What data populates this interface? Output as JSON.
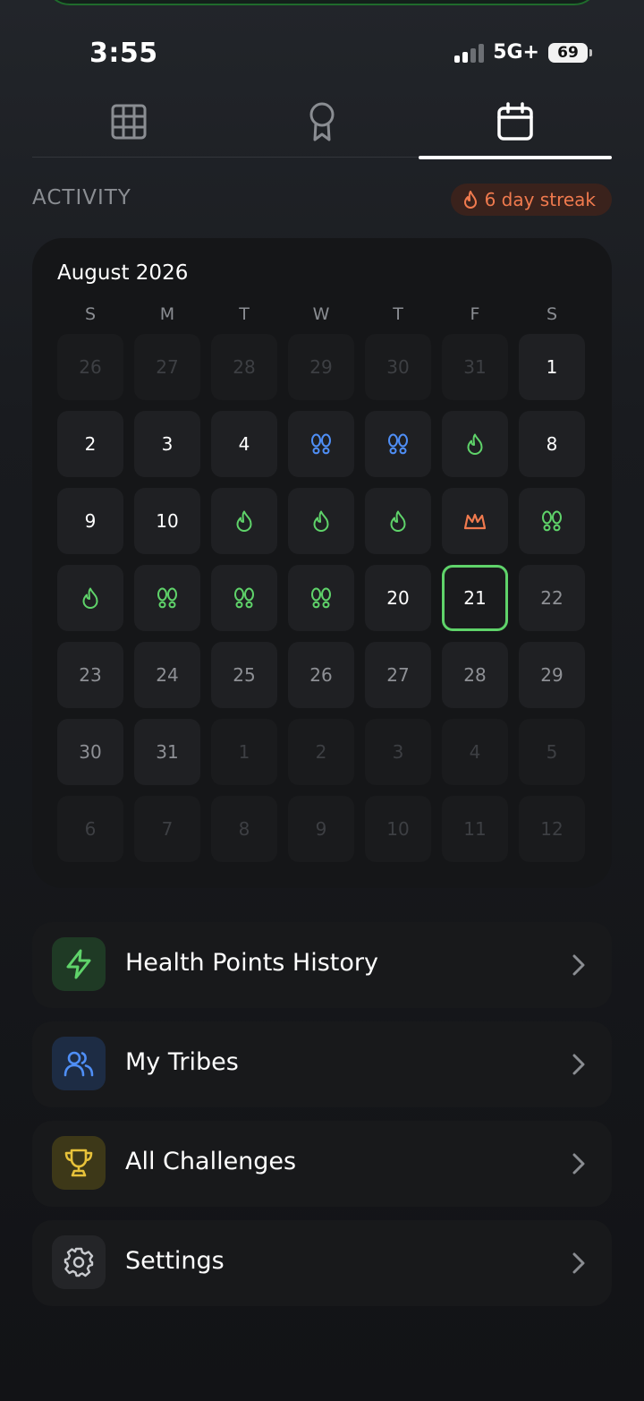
{
  "status_bar": {
    "time": "3:55",
    "network": "5G+",
    "battery": "69"
  },
  "tabs": [
    {
      "icon": "grid-icon",
      "active": false
    },
    {
      "icon": "award-icon",
      "active": false
    },
    {
      "icon": "calendar-icon",
      "active": true
    }
  ],
  "activity": {
    "title": "ACTIVITY",
    "streak_label": "6 day streak"
  },
  "calendar": {
    "month": "August 2026",
    "weekdays": [
      "S",
      "M",
      "T",
      "W",
      "T",
      "F",
      "S"
    ],
    "weeks": [
      [
        {
          "d": "26",
          "s": "other"
        },
        {
          "d": "27",
          "s": "other"
        },
        {
          "d": "28",
          "s": "other"
        },
        {
          "d": "29",
          "s": "other"
        },
        {
          "d": "30",
          "s": "other"
        },
        {
          "d": "31",
          "s": "other"
        },
        {
          "d": "1",
          "s": "current"
        }
      ],
      [
        {
          "d": "2",
          "s": "current"
        },
        {
          "d": "3",
          "s": "current"
        },
        {
          "d": "4",
          "s": "current"
        },
        {
          "icon": "footsteps-blue"
        },
        {
          "icon": "footsteps-blue"
        },
        {
          "icon": "flame-green"
        },
        {
          "d": "8",
          "s": "current"
        }
      ],
      [
        {
          "d": "9",
          "s": "current"
        },
        {
          "d": "10",
          "s": "current"
        },
        {
          "icon": "flame-green"
        },
        {
          "icon": "flame-green"
        },
        {
          "icon": "flame-green"
        },
        {
          "icon": "crown-orange"
        },
        {
          "icon": "footsteps-green"
        }
      ],
      [
        {
          "icon": "flame-green"
        },
        {
          "icon": "footsteps-green"
        },
        {
          "icon": "footsteps-green"
        },
        {
          "icon": "footsteps-green"
        },
        {
          "d": "20",
          "s": "current"
        },
        {
          "d": "21",
          "s": "today"
        },
        {
          "d": "22",
          "s": "future"
        }
      ],
      [
        {
          "d": "23",
          "s": "future"
        },
        {
          "d": "24",
          "s": "future"
        },
        {
          "d": "25",
          "s": "future"
        },
        {
          "d": "26",
          "s": "future"
        },
        {
          "d": "27",
          "s": "future"
        },
        {
          "d": "28",
          "s": "future"
        },
        {
          "d": "29",
          "s": "future"
        }
      ],
      [
        {
          "d": "30",
          "s": "future"
        },
        {
          "d": "31",
          "s": "future"
        },
        {
          "d": "1",
          "s": "other"
        },
        {
          "d": "2",
          "s": "other"
        },
        {
          "d": "3",
          "s": "other"
        },
        {
          "d": "4",
          "s": "other"
        },
        {
          "d": "5",
          "s": "other"
        }
      ],
      [
        {
          "d": "6",
          "s": "other"
        },
        {
          "d": "7",
          "s": "other"
        },
        {
          "d": "8",
          "s": "other"
        },
        {
          "d": "9",
          "s": "other"
        },
        {
          "d": "10",
          "s": "other"
        },
        {
          "d": "11",
          "s": "other"
        },
        {
          "d": "12",
          "s": "other"
        }
      ]
    ]
  },
  "menu": [
    {
      "label": "Health Points History",
      "icon": "lightning-icon"
    },
    {
      "label": "My Tribes",
      "icon": "users-icon"
    },
    {
      "label": "All Challenges",
      "icon": "trophy-icon"
    },
    {
      "label": "Settings",
      "icon": "gear-icon"
    }
  ],
  "colors": {
    "accent_green": "#5fd36a",
    "accent_blue": "#4f8ff7",
    "accent_orange": "#f07a4e",
    "accent_yellow": "#e7c23a"
  }
}
